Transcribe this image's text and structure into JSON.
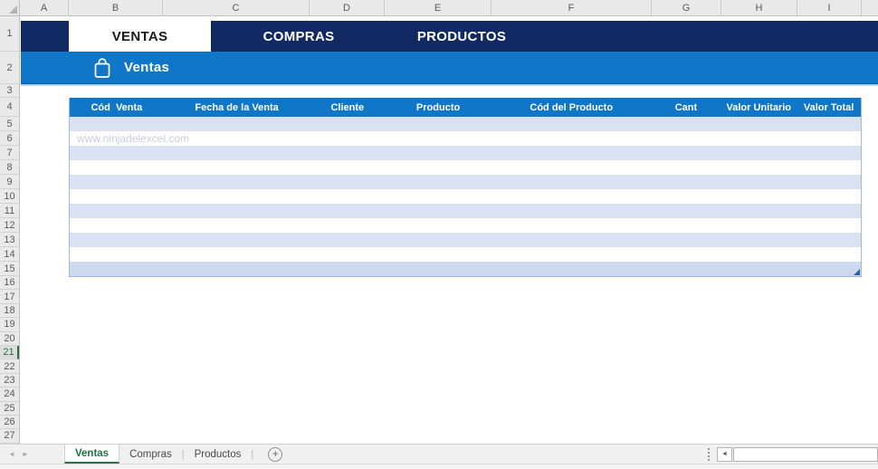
{
  "spreadsheet": {
    "column_headers": [
      "A",
      "B",
      "C",
      "D",
      "E",
      "F",
      "G",
      "H",
      "I"
    ],
    "row_numbers": [
      1,
      2,
      3,
      4,
      5,
      6,
      7,
      8,
      9,
      10,
      11,
      12,
      13,
      14,
      15,
      16,
      17,
      18,
      19,
      20,
      21,
      22,
      23,
      24,
      25,
      26,
      27
    ],
    "active_row": 21
  },
  "nav_banner": {
    "tabs": [
      {
        "label": "VENTAS",
        "active": true
      },
      {
        "label": "COMPRAS",
        "active": false
      },
      {
        "label": "PRODUCTOS",
        "active": false
      }
    ]
  },
  "title_bar": {
    "icon": "shopping-bag-icon",
    "title": "Ventas"
  },
  "table": {
    "headers": [
      "Cód  Venta",
      "Fecha de la Venta",
      "Cliente",
      "Producto",
      "Cód del Producto",
      "Cant",
      "Valor Unitario",
      "Valor Total"
    ],
    "body_row_count": 11,
    "watermark": "www.ninjadelexcel.com",
    "watermark_row_index": 1
  },
  "sheet_tab_bar": {
    "nav_left": "◄",
    "nav_right": "►",
    "tabs": [
      {
        "label": "Ventas",
        "active": true
      },
      {
        "label": "Compras",
        "active": false
      },
      {
        "label": "Productos",
        "active": false
      }
    ],
    "divider": "|",
    "add_sheet_label": "+",
    "hscroll_left_arrow": "◄"
  },
  "colors": {
    "navy": "#122a63",
    "blue": "#0f76c8",
    "stripe": "#d9e1f2",
    "stripe_last": "#ccd8ed",
    "tab_green": "#217346"
  }
}
